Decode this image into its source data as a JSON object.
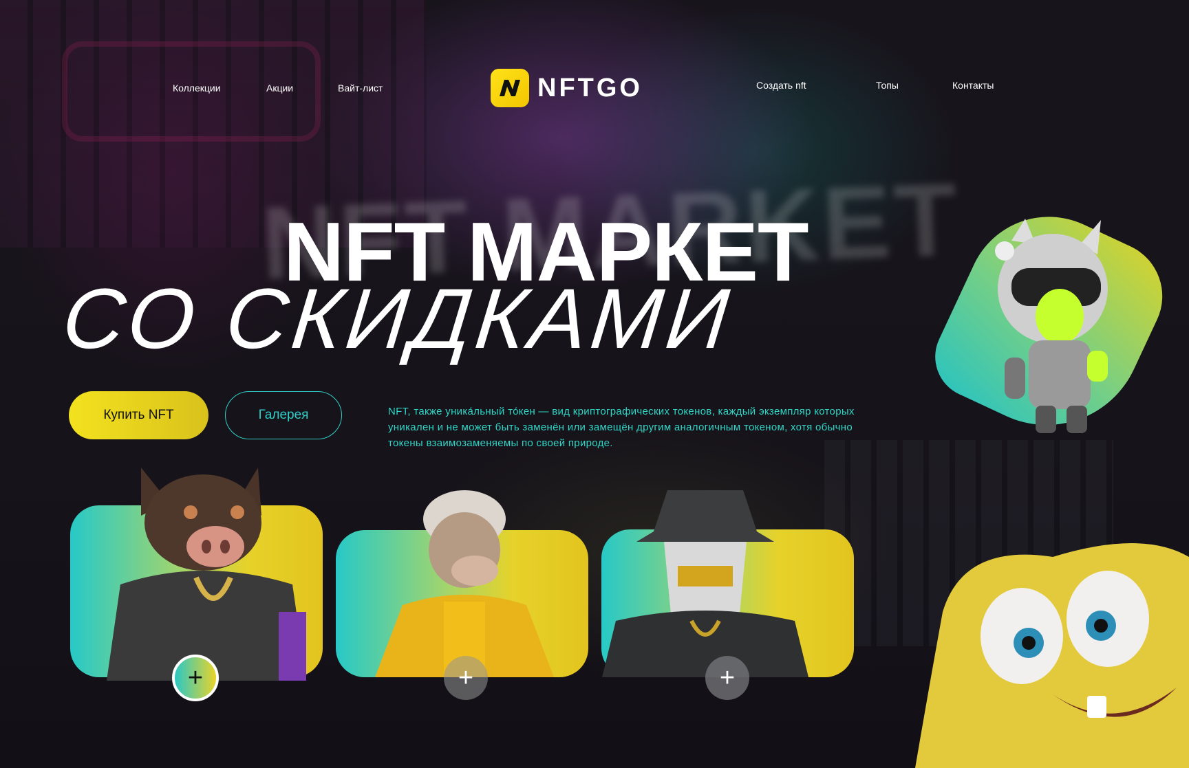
{
  "nav": {
    "left": [
      "Коллекции",
      "Акции",
      "Вайт-лист"
    ],
    "right": [
      "Создать nft",
      "Топы",
      "Контакты"
    ]
  },
  "logo": {
    "text": "NFTGO",
    "mark": "N"
  },
  "hero": {
    "title_line1": "NFT МАРКЕТ",
    "title_line2": "СО СКИДКАМИ",
    "background_text": "NFT MARKET",
    "description": "NFT, также уника́льный то́кен — вид криптографических токенов, каждый экземпляр которых уникален и не может быть заменён или замещён другим аналогичным токеном, хотя обычно токены взаимозаменяемы по своей природе."
  },
  "buttons": {
    "buy": "Купить NFT",
    "gallery": "Галерея"
  },
  "cards": [
    {
      "character": "boar-character",
      "add": "+"
    },
    {
      "character": "ape-character",
      "add": "+"
    },
    {
      "character": "masked-character",
      "add": "+"
    }
  ],
  "decor": {
    "pilot_character": "cat-pilot-figure",
    "sponge_character": "sponge-character"
  },
  "colors": {
    "accent_yellow": "#f3e21f",
    "accent_teal": "#2fd1c8",
    "background": "#141218"
  }
}
